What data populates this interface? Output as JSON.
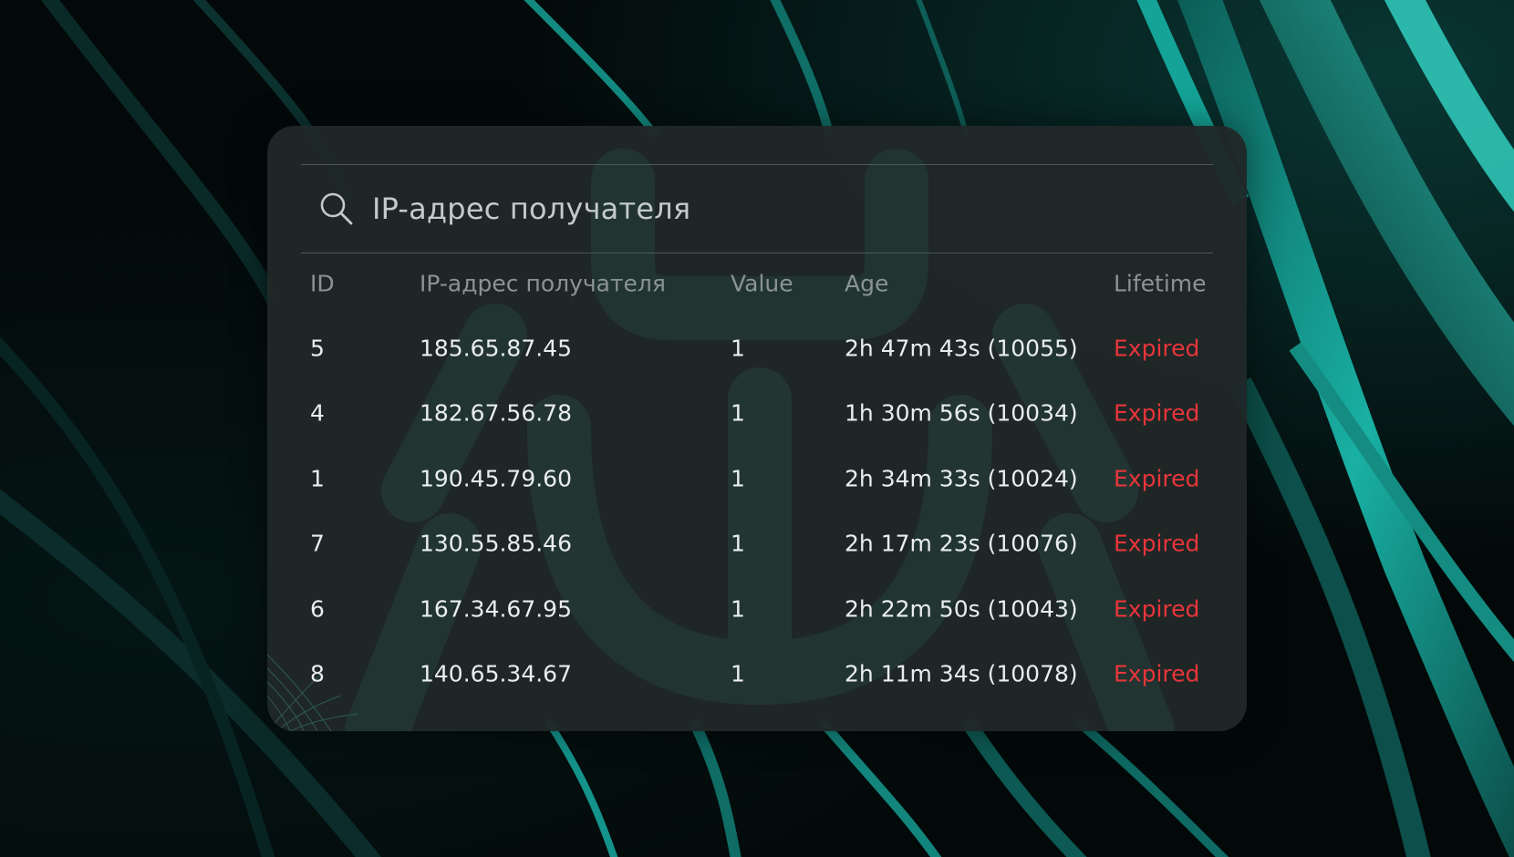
{
  "search": {
    "icon": "search-icon",
    "text": "IP-адрес получателя"
  },
  "table": {
    "columns": [
      "ID",
      "IP-адрес получателя",
      "Value",
      "Age",
      "Lifetime"
    ],
    "rows": [
      {
        "id": "5",
        "ip": "185.65.87.45",
        "value": "1",
        "age": "2h 47m 43s (10055)",
        "lifetime": "Expired"
      },
      {
        "id": "4",
        "ip": "182.67.56.78",
        "value": "1",
        "age": "1h 30m 56s (10034)",
        "lifetime": "Expired"
      },
      {
        "id": "1",
        "ip": "190.45.79.60",
        "value": "1",
        "age": "2h 34m 33s (10024)",
        "lifetime": "Expired"
      },
      {
        "id": "7",
        "ip": "130.55.85.46",
        "value": "1",
        "age": "2h 17m 23s (10076)",
        "lifetime": "Expired"
      },
      {
        "id": "6",
        "ip": "167.34.67.95",
        "value": "1",
        "age": "2h 22m 50s (10043)",
        "lifetime": "Expired"
      },
      {
        "id": "8",
        "ip": "140.65.34.67",
        "value": "1",
        "age": "2h 11m 34s (10078)",
        "lifetime": "Expired"
      }
    ]
  },
  "colors": {
    "panel": "#202828",
    "text": "#e9eded",
    "header_text": "#8b9393",
    "expired": "#e8353a",
    "accent": "#1fb3a8"
  }
}
